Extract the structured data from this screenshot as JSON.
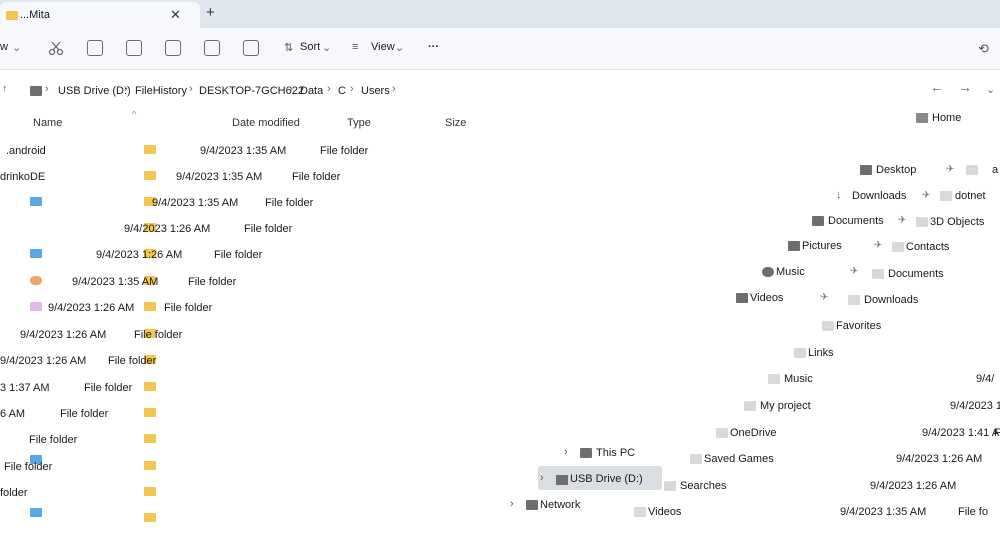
{
  "tab": {
    "title": "...Mita",
    "close": "✕",
    "new": "+"
  },
  "toolbar": {
    "view_partial": "w",
    "sort": "Sort",
    "view": "View",
    "more": "···"
  },
  "address": {
    "crumbs": [
      "USB Drive (D:)",
      "FileHistory",
      "DESKTOP-7GCH622",
      "Data",
      "C",
      "Users"
    ]
  },
  "nav": {
    "back": "←",
    "forward": "→"
  },
  "columns": {
    "name": "Name",
    "date": "Date modified",
    "type": "Type",
    "size": "Size"
  },
  "rows": [
    {
      "name": ".android",
      "date": "9/4/2023 1:35 AM",
      "type": "File folder"
    },
    {
      "name": "drinkoDE",
      "date": "9/4/2023 1:35 AM",
      "type": "File folder"
    },
    {
      "name": "",
      "date": "9/4/2023 1:35 AM",
      "type": "File folder"
    },
    {
      "name": "",
      "date": "9/4/2023 1:26 AM",
      "type": "File folder"
    },
    {
      "name": "",
      "date": "9/4/2023 1:26 AM",
      "type": "File folder"
    },
    {
      "name": "",
      "date": "9/4/2023 1:35 AM",
      "type": "File folder"
    },
    {
      "name": "",
      "date": "9/4/2023 1:26 AM",
      "type": "File folder"
    },
    {
      "name": "",
      "date": "9/4/2023 1:26 AM",
      "type": "File folder"
    },
    {
      "name": "",
      "date": "9/4/2023 1:26 AM",
      "type": "File folder"
    },
    {
      "name": "",
      "date": "3 1:37 AM",
      "type": "File folder"
    },
    {
      "name": "",
      "date": "6 AM",
      "type": "File folder"
    },
    {
      "name": "",
      "date": "",
      "type": "File folder"
    },
    {
      "name": "",
      "date": "",
      "type": "File folder"
    },
    {
      "name": "",
      "date": "",
      "type": "folder"
    }
  ],
  "sidebar": {
    "home": "Home",
    "quick": [
      "Desktop",
      "Downloads",
      "Documents",
      "Pictures",
      "Music",
      "Videos"
    ],
    "this_pc": "This PC",
    "usb": "USB Drive (D:)",
    "network": "Network"
  },
  "right_list": [
    {
      "name": "a",
      "date": ""
    },
    {
      "name": "dotnet",
      "date": ""
    },
    {
      "name": "3D Objects",
      "date": ""
    },
    {
      "name": "Contacts",
      "date": ""
    },
    {
      "name": "Documents",
      "date": ""
    },
    {
      "name": "Downloads",
      "date": ""
    },
    {
      "name": "Favorites",
      "date": ""
    },
    {
      "name": "Links",
      "date": ""
    },
    {
      "name": "Music",
      "date": "9/4/"
    },
    {
      "name": "My project",
      "date": "9/4/2023 1:3"
    },
    {
      "name": "OneDrive",
      "date": "9/4/2023 1:41 AM"
    },
    {
      "name": "Saved Games",
      "date": "9/4/2023 1:26 AM"
    },
    {
      "name": "Searches",
      "date": "9/4/2023 1:26 AM"
    },
    {
      "name": "Videos",
      "date": "9/4/2023 1:35 AM"
    }
  ],
  "right_types": {
    "r10": "F",
    "r13": "File fo"
  }
}
